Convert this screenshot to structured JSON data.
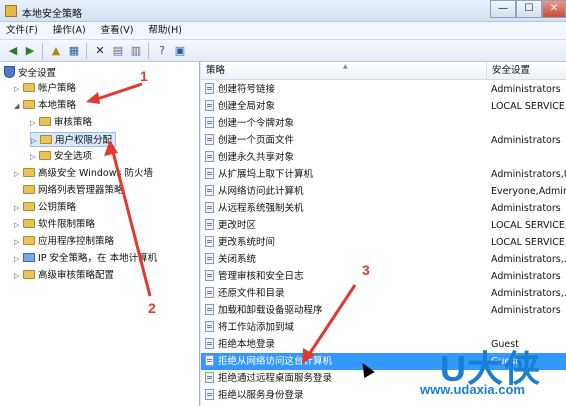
{
  "window": {
    "title": "本地安全策略",
    "controls": {
      "minimize": "—",
      "maximize": "☐",
      "close": "✕"
    }
  },
  "menu": [
    "文件(F)",
    "操作(A)",
    "查看(V)",
    "帮助(H)"
  ],
  "toolbar": {
    "icons": [
      "back-icon",
      "forward-icon",
      "up-folder-icon",
      "show-hide-tree-icon",
      "delete-icon",
      "properties-icon",
      "export-list-icon",
      "help-icon",
      "console-icon"
    ]
  },
  "tree": {
    "root": "安全设置",
    "items": [
      {
        "label": "帐户策略",
        "level": 1
      },
      {
        "label": "本地策略",
        "level": 1,
        "expanded": true
      },
      {
        "label": "审核策略",
        "level": 2
      },
      {
        "label": "用户权限分配",
        "level": 2,
        "selected": true
      },
      {
        "label": "安全选项",
        "level": 2
      },
      {
        "label": "高级安全 Windows 防火墙",
        "level": 1
      },
      {
        "label": "网络列表管理器策略",
        "level": 1
      },
      {
        "label": "公钥策略",
        "level": 1
      },
      {
        "label": "软件限制策略",
        "level": 1
      },
      {
        "label": "应用程序控制策略",
        "level": 1
      },
      {
        "label": "IP 安全策略，在 本地计算机",
        "level": 1
      },
      {
        "label": "高级审核策略配置",
        "level": 1
      }
    ]
  },
  "list": {
    "columns": {
      "policy": "策略",
      "setting": "安全设置"
    },
    "rows": [
      {
        "policy": "创建符号链接",
        "setting": "Administrators"
      },
      {
        "policy": "创建全局对象",
        "setting": "LOCAL SERVICE,..."
      },
      {
        "policy": "创建一个令牌对象",
        "setting": ""
      },
      {
        "policy": "创建一个页面文件",
        "setting": "Administrators"
      },
      {
        "policy": "创建永久共享对象",
        "setting": ""
      },
      {
        "policy": "从扩展坞上取下计算机",
        "setting": "Administrators,U..."
      },
      {
        "policy": "从网络访问此计算机",
        "setting": "Everyone,Admin..."
      },
      {
        "policy": "从远程系统强制关机",
        "setting": "Administrators"
      },
      {
        "policy": "更改时区",
        "setting": "LOCAL SERVICE,..."
      },
      {
        "policy": "更改系统时间",
        "setting": "LOCAL SERVICE,..."
      },
      {
        "policy": "关闭系统",
        "setting": "Administrators,..."
      },
      {
        "policy": "管理审核和安全日志",
        "setting": "Administrators"
      },
      {
        "policy": "还原文件和目录",
        "setting": "Administrators,..."
      },
      {
        "policy": "加载和卸载设备驱动程序",
        "setting": "Administrators"
      },
      {
        "policy": "将工作站添加到域",
        "setting": ""
      },
      {
        "policy": "拒绝本地登录",
        "setting": "Guest"
      },
      {
        "policy": "拒绝从网络访问这台计算机",
        "setting": "Guest",
        "selected": true
      },
      {
        "policy": "拒绝通过远程桌面服务登录",
        "setting": ""
      },
      {
        "policy": "拒绝以服务身份登录",
        "setting": ""
      }
    ]
  },
  "annotations": [
    "1",
    "2",
    "3"
  ],
  "watermark": {
    "logo": "U大侠",
    "url": "www.udaxia.com"
  },
  "colors": {
    "annotation": "#e03a2e",
    "selection": "#3399ff",
    "watermark": "#1a7fd0"
  }
}
